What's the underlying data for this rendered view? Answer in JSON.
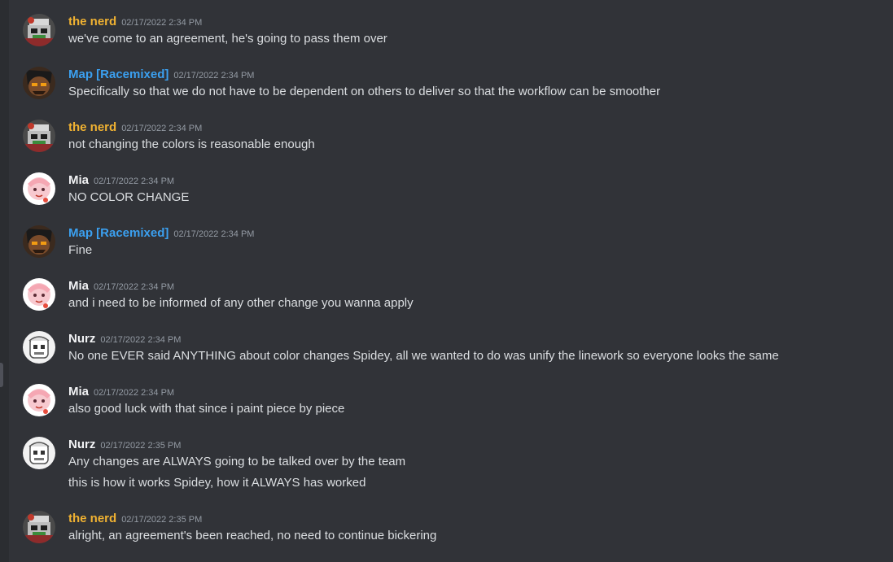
{
  "colors": {
    "the_nerd": "#f0b232",
    "map": "#3ba0f0",
    "mia": "#f2f3f5",
    "nurz": "#f2f3f5",
    "text": "#dbdee1",
    "timestamp": "#949ba4",
    "background": "#313338"
  },
  "messages": [
    {
      "author": "the nerd",
      "avatar": "the-nerd-avatar",
      "timestamp": "02/17/2022 2:34 PM",
      "lines": [
        "we've come to an agreement, he's going to pass them over"
      ]
    },
    {
      "author": "Map [Racemixed]",
      "avatar": "map-avatar",
      "timestamp": "02/17/2022 2:34 PM",
      "lines": [
        "Specifically so that we do not have to be dependent on others to deliver so that the workflow can be smoother"
      ]
    },
    {
      "author": "the nerd",
      "avatar": "the-nerd-avatar",
      "timestamp": "02/17/2022 2:34 PM",
      "lines": [
        "not changing the colors is reasonable enough"
      ]
    },
    {
      "author": "Mia",
      "avatar": "mia-avatar",
      "timestamp": "02/17/2022 2:34 PM",
      "lines": [
        "NO COLOR CHANGE"
      ]
    },
    {
      "author": "Map [Racemixed]",
      "avatar": "map-avatar",
      "timestamp": "02/17/2022 2:34 PM",
      "lines": [
        "Fine"
      ]
    },
    {
      "author": "Mia",
      "avatar": "mia-avatar",
      "timestamp": "02/17/2022 2:34 PM",
      "lines": [
        "and i need to be informed of any other change you wanna apply"
      ]
    },
    {
      "author": "Nurz",
      "avatar": "nurz-avatar",
      "timestamp": "02/17/2022 2:34 PM",
      "lines": [
        "No one EVER  said ANYTHING about color changes Spidey, all we wanted to do was unify the linework so everyone looks the same"
      ]
    },
    {
      "author": "Mia",
      "avatar": "mia-avatar",
      "timestamp": "02/17/2022 2:34 PM",
      "lines": [
        "also good luck with that since i paint piece by piece"
      ]
    },
    {
      "author": "Nurz",
      "avatar": "nurz-avatar",
      "timestamp": "02/17/2022 2:35 PM",
      "lines": [
        "Any changes are ALWAYS going to be talked over by the team",
        "this is how it works Spidey, how it ALWAYS has worked"
      ]
    },
    {
      "author": "the nerd",
      "avatar": "the-nerd-avatar",
      "timestamp": "02/17/2022 2:35 PM",
      "lines": [
        "alright, an agreement's been reached, no need to continue bickering"
      ]
    }
  ]
}
